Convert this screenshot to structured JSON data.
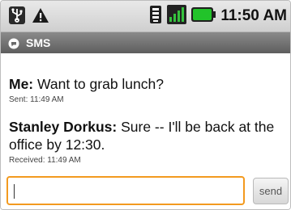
{
  "status_bar": {
    "time": "11:50 AM",
    "icons": [
      "usb-icon",
      "warning-icon",
      "vibrate-icon",
      "signal-icon",
      "battery-icon"
    ],
    "battery_color": "#22c32a"
  },
  "title_bar": {
    "icon": "sms-bubble-icon",
    "title": "SMS"
  },
  "messages": [
    {
      "sender": "Me:",
      "text": "Want to grab lunch?",
      "meta": "Sent: 11:49 AM"
    },
    {
      "sender": "Stanley Dorkus:",
      "text": "Sure -- I'll be back at the office by 12:30.",
      "meta": "Received: 11:49 AM"
    }
  ],
  "compose": {
    "value": "",
    "send_label": "send",
    "focus_color": "#f39a1f"
  }
}
